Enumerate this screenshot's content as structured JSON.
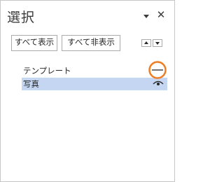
{
  "pane": {
    "title": "選択",
    "menu_icon": "chevron-down-icon",
    "close_icon": "close-icon",
    "close_glyph": "✕"
  },
  "toolbar": {
    "show_all_label": "すべて表示",
    "hide_all_label": "すべて非表示",
    "bring_forward_icon": "triangle-up-icon",
    "send_backward_icon": "triangle-down-icon"
  },
  "layers": [
    {
      "label": "テンプレート",
      "visible": false,
      "selected": false,
      "highlighted_control": true
    },
    {
      "label": "写真",
      "visible": true,
      "selected": true,
      "highlighted_control": false
    }
  ],
  "colors": {
    "selection_row": "#c5d6f3",
    "highlight_ring": "#ef7d22",
    "text": "#262626",
    "border": "#ababab"
  }
}
